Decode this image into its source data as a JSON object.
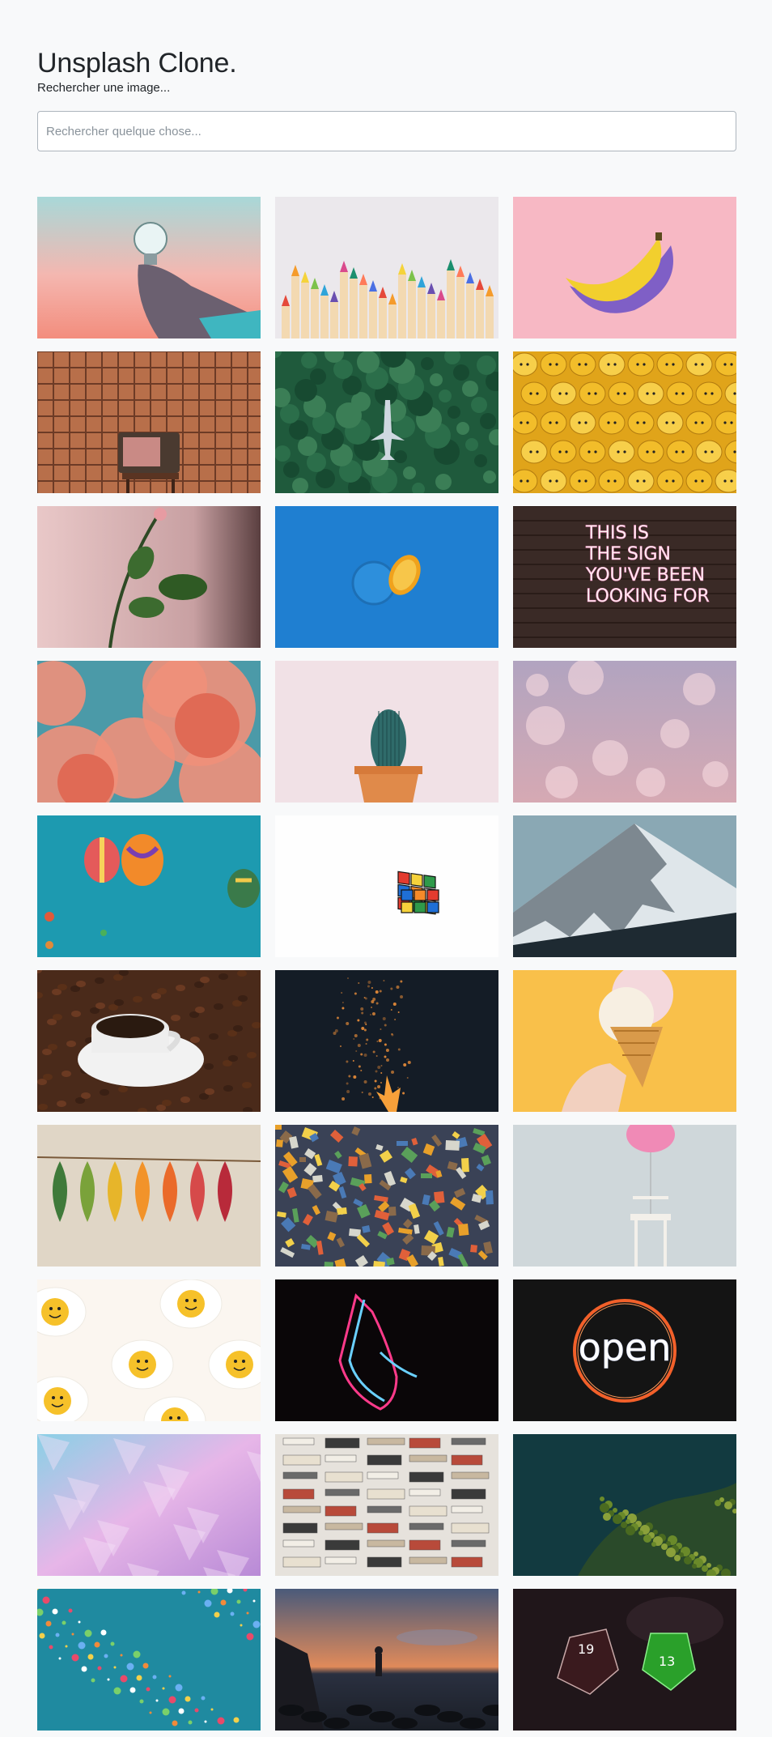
{
  "header": {
    "title": "Unsplash Clone.",
    "subtitle": "Rechercher une image..."
  },
  "search": {
    "placeholder": "Rechercher quelque chose...",
    "value": ""
  },
  "gallery": {
    "images": [
      {
        "name": "lightbulb-photo"
      },
      {
        "name": "colored-pencils-photo"
      },
      {
        "name": "banana-photo"
      },
      {
        "name": "vintage-tv-photo"
      },
      {
        "name": "airplane-over-forest-photo"
      },
      {
        "name": "lego-heads-photo"
      },
      {
        "name": "rose-stem-photo"
      },
      {
        "name": "blue-orange-photo"
      },
      {
        "name": "neon-sign-photo",
        "caption": "THIS IS THE SIGN YOU'VE BEEN LOOKING FOR"
      },
      {
        "name": "pink-clouds-photo"
      },
      {
        "name": "cactus-photo"
      },
      {
        "name": "bokeh-lights-photo"
      },
      {
        "name": "hot-air-balloons-photo"
      },
      {
        "name": "rubiks-cube-photo"
      },
      {
        "name": "snowy-mountain-photo"
      },
      {
        "name": "coffee-cup-photo"
      },
      {
        "name": "campfire-sparks-photo"
      },
      {
        "name": "ice-cream-cone-photo"
      },
      {
        "name": "autumn-leaves-photo"
      },
      {
        "name": "puzzle-pieces-photo"
      },
      {
        "name": "pink-balloon-chair-photo"
      },
      {
        "name": "smiley-eggs-photo"
      },
      {
        "name": "neon-praying-hands-photo"
      },
      {
        "name": "neon-open-sign-photo",
        "caption": "open"
      },
      {
        "name": "crystals-photo"
      },
      {
        "name": "book-stacks-photo"
      },
      {
        "name": "mossy-water-photo"
      },
      {
        "name": "confetti-photo"
      },
      {
        "name": "sunset-rocks-photo"
      },
      {
        "name": "dice-photo",
        "caption": "19 13"
      }
    ]
  }
}
